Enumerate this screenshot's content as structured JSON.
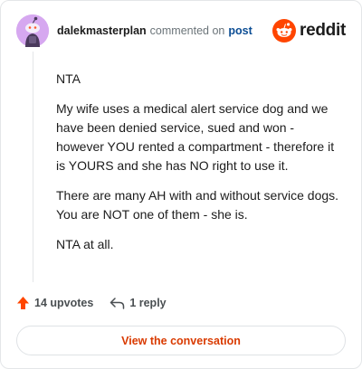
{
  "header": {
    "username": "dalekmasterplan",
    "commented_text": "commented on",
    "post_link": "post",
    "brand": "reddit"
  },
  "comment": {
    "paragraphs": [
      "NTA",
      "My wife uses a medical alert service dog and we have been denied service, sued and won - however YOU rented a compartment - therefore it is YOURS and she has NO right to use it.",
      "There are many AH with and without service dogs. You are NOT one of them - she is.",
      "NTA at all."
    ]
  },
  "actions": {
    "upvotes": "14 upvotes",
    "replies": "1 reply"
  },
  "cta": {
    "label": "View the conversation"
  },
  "colors": {
    "brand_orange": "#ff4500",
    "upvote_arrow": "#ff4500",
    "cta_text": "#d93a00",
    "link_blue": "#0b4d94",
    "avatar_bg": "#d6a8f0"
  },
  "icons": [
    "snoo-avatar-icon",
    "reddit-logo-icon",
    "upvote-arrow-icon",
    "reply-arrow-icon"
  ]
}
